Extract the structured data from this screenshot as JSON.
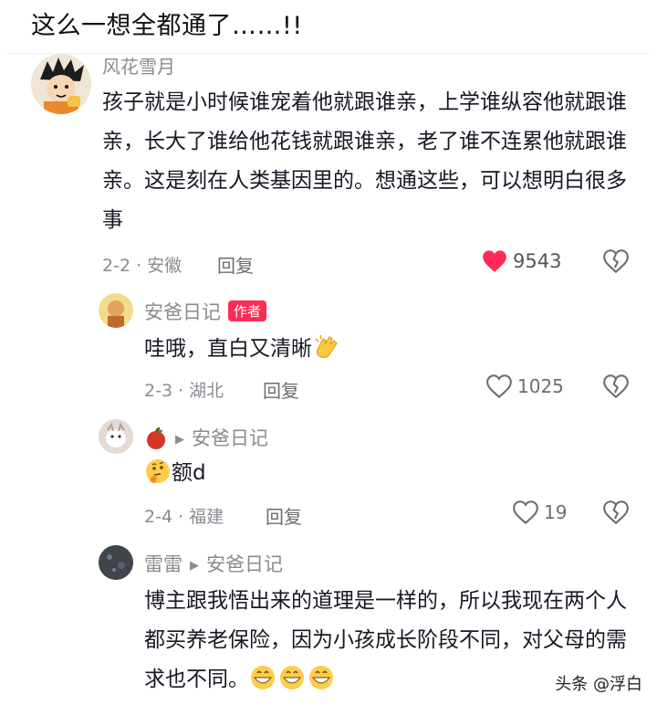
{
  "post": {
    "title": "这么一想全都通了……!!"
  },
  "comments": [
    {
      "user": "风花雪月",
      "text": "孩子就是小时候谁宠着他就跟谁亲，上学谁纵容他就跟谁亲，长大了谁给他花钱就跟谁亲，老了谁不连累他就跟谁亲。这是刻在人类基因里的。想通这些，可以想明白很多事",
      "meta": "2-2 · 安徽",
      "reply_label": "回复",
      "likes": "9543"
    },
    {
      "user": "安爸日记",
      "badge": "作者",
      "text": "哇哦，直白又清晰",
      "meta": "2-3 · 湖北",
      "reply_label": "回复",
      "likes": "1025"
    },
    {
      "user_reply_to": "安爸日记",
      "text": "额d",
      "meta": "2-4 · 福建",
      "reply_label": "回复",
      "likes": "19"
    },
    {
      "user": "雷雷",
      "user_reply_to": "安爸日记",
      "text": "博主跟我悟出来的道理是一样的，所以我现在两个人都买养老保险，因为小孩成长阶段不同，对父母的需求也不同。"
    }
  ],
  "watermark": "头条 @浮白",
  "colors": {
    "like_active": "#fe2c55",
    "badge": "#fe2c55"
  }
}
